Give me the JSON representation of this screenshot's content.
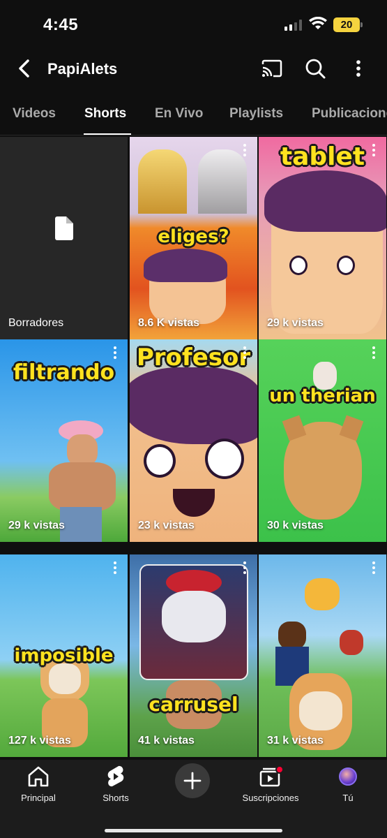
{
  "status_bar": {
    "time": "4:45",
    "battery": "20"
  },
  "header": {
    "title": "PapiAlets"
  },
  "tabs": [
    {
      "label": "Videos",
      "active": false
    },
    {
      "label": "Shorts",
      "active": true
    },
    {
      "label": "En Vivo",
      "active": false
    },
    {
      "label": "Playlists",
      "active": false
    },
    {
      "label": "Publicaciones",
      "active": false
    }
  ],
  "drafts": {
    "label": "Borradores"
  },
  "shorts": [
    {
      "caption": "eliges?",
      "views": "8.6 K vistas"
    },
    {
      "caption": "tablet",
      "views": "29 k vistas"
    },
    {
      "caption": "filtrando",
      "views": "29 k vistas"
    },
    {
      "caption": "Profesor",
      "views": "23 k vistas"
    },
    {
      "caption": "un therian",
      "views": "30 k vistas"
    },
    {
      "caption": "imposible",
      "views": "127 k vistas"
    },
    {
      "caption": "carrusel",
      "views": "41 k vistas"
    },
    {
      "caption": "",
      "views": "31 k vistas"
    }
  ],
  "bottom_nav": [
    {
      "label": "Principal",
      "icon": "home-icon"
    },
    {
      "label": "Shorts",
      "icon": "shorts-icon"
    },
    {
      "label": "",
      "icon": "create-icon"
    },
    {
      "label": "Suscripciones",
      "icon": "subscriptions-icon"
    },
    {
      "label": "Tú",
      "icon": "avatar"
    }
  ],
  "colors": {
    "background": "#0f0f0f",
    "caption_yellow": "#ffe21f",
    "notification_red": "#ff0033",
    "battery": "#f5d33f"
  }
}
